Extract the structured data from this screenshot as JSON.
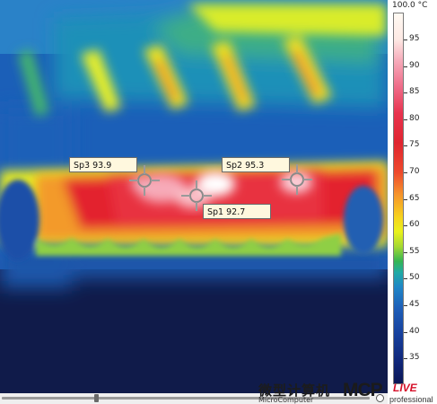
{
  "scale": {
    "max_label": "100.0 °C",
    "ticks": [
      "95",
      "90",
      "85",
      "80",
      "75",
      "70",
      "65",
      "60",
      "55",
      "50",
      "45",
      "40",
      "35"
    ]
  },
  "spots": [
    {
      "name": "Sp3",
      "value": "93.9",
      "label": "Sp3 93.9"
    },
    {
      "name": "Sp2",
      "value": "95.3",
      "label": "Sp2 95.3"
    },
    {
      "name": "Sp1",
      "value": "92.7",
      "label": "Sp1 92.7"
    }
  ],
  "watermark": {
    "chinese": "微型计算机",
    "english": "MicroComputer",
    "brand": "MCP",
    "live": "LIVE",
    "sub": "professional"
  },
  "colors": {
    "hot": "#ffffff",
    "red": "#e2202e",
    "orange": "#f39a2a",
    "yellow": "#f5ea1e",
    "green": "#4cb84c",
    "cyan": "#22a8b8",
    "blue": "#1e62c0",
    "navy": "#0f1c4f"
  }
}
